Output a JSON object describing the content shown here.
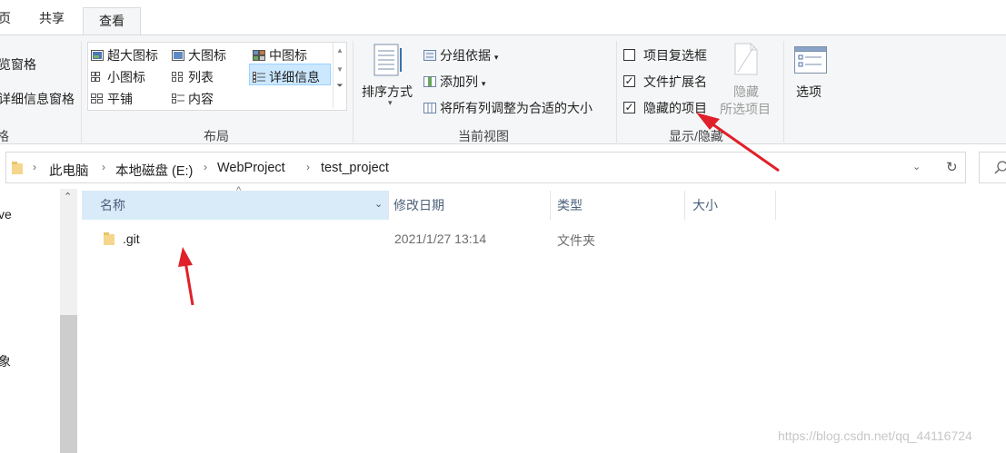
{
  "tabs": [
    {
      "label": "页"
    },
    {
      "label": "共享"
    },
    {
      "label": "查看"
    }
  ],
  "ribbon": {
    "pane_group": {
      "preview_label": "览窗格",
      "details_label": "详细信息窗格",
      "group_label": "格"
    },
    "layout_group": {
      "items": [
        {
          "label": "超大图标"
        },
        {
          "label": "大图标"
        },
        {
          "label": "中图标"
        },
        {
          "label": "小图标"
        },
        {
          "label": "列表"
        },
        {
          "label": "详细信息"
        },
        {
          "label": "平铺"
        },
        {
          "label": "内容"
        }
      ],
      "selected": "详细信息",
      "group_label": "布局"
    },
    "view_group": {
      "sort_label": "排序方式",
      "group_by_label": "分组依据",
      "add_column_label": "添加列",
      "fit_columns_label": "将所有列调整为合适的大小",
      "group_label": "当前视图"
    },
    "show_hide_group": {
      "checkboxes": [
        {
          "label": "项目复选框",
          "checked": false
        },
        {
          "label": "文件扩展名",
          "checked": true
        },
        {
          "label": "隐藏的项目",
          "checked": true
        }
      ],
      "hide_selected_line1": "隐藏",
      "hide_selected_line2": "所选项目",
      "group_label": "显示/隐藏"
    },
    "options_label": "选项"
  },
  "address": {
    "crumbs": [
      "此电脑",
      "本地磁盘 (E:)",
      "WebProject",
      "test_project"
    ]
  },
  "nav": {
    "item_top": "ve",
    "item_bottom": "象"
  },
  "columns": {
    "name": "名称",
    "modified": "修改日期",
    "type": "类型",
    "size": "大小"
  },
  "files": [
    {
      "name": ".git",
      "modified": "2021/1/27 13:14",
      "type": "文件夹",
      "size": ""
    }
  ],
  "watermark": "https://blog.csdn.net/qq_44116724",
  "colors": {
    "arrow": "#e0202a",
    "selection": "#cce8ff",
    "header_selected": "#d9ebf9",
    "folder": "#f5d68c"
  }
}
